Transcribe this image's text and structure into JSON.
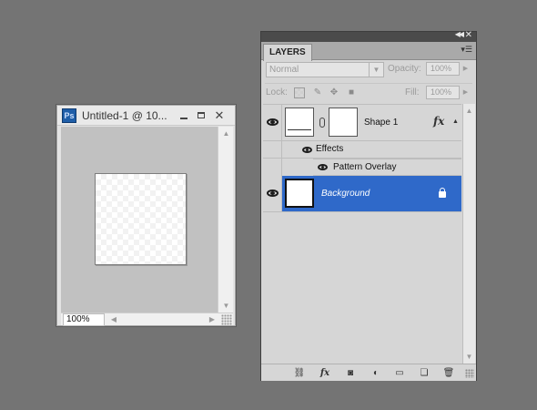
{
  "document_window": {
    "badge": "Ps",
    "title": "Untitled-1 @ 10...",
    "zoom": "100%"
  },
  "layers_panel": {
    "tab_label": "LAYERS",
    "blend_mode": "Normal",
    "opacity_label": "Opacity:",
    "opacity_value": "100%",
    "lock_label": "Lock:",
    "fill_label": "Fill:",
    "fill_value": "100%",
    "layers": [
      {
        "name": "Shape 1",
        "has_fx": true,
        "fx_label": "fx"
      },
      {
        "name": "Background",
        "selected": true,
        "locked": true
      }
    ],
    "effects_label": "Effects",
    "effects": [
      "Pattern Overlay"
    ],
    "footer_icons": [
      "link-layers-icon",
      "fx-icon",
      "add-mask-icon",
      "adjustment-layer-icon",
      "new-group-icon",
      "new-layer-icon",
      "trash-icon"
    ]
  },
  "colors": {
    "workspace": "#747474",
    "selection": "#2f69c9"
  }
}
